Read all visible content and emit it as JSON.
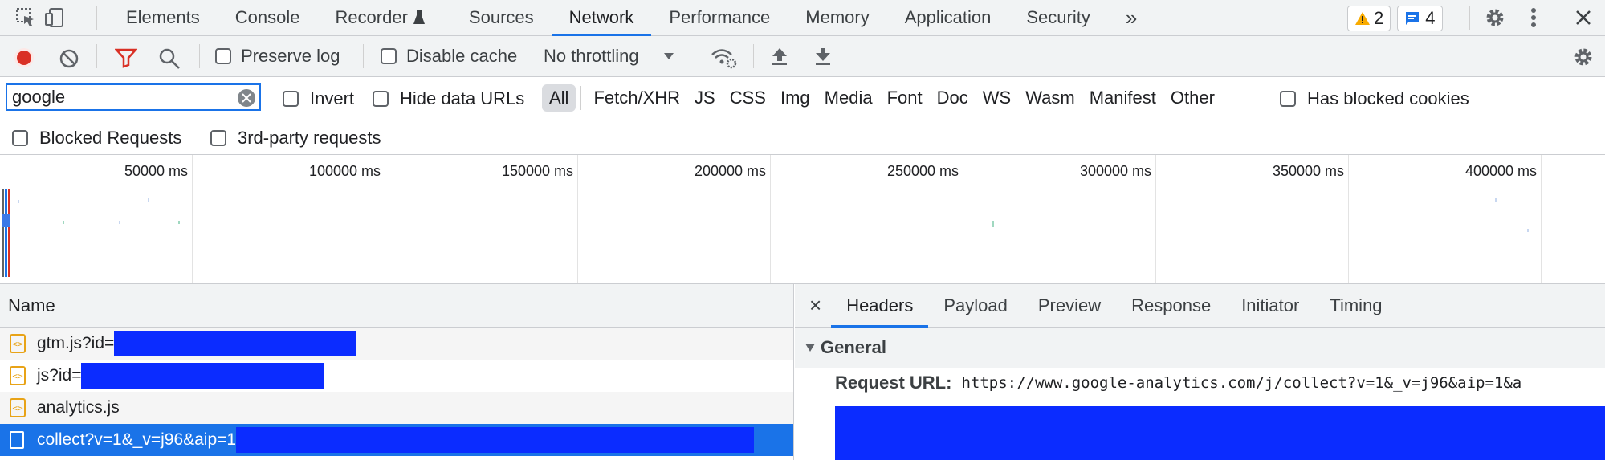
{
  "tabs": {
    "items": [
      "Elements",
      "Console",
      "Recorder",
      "Sources",
      "Network",
      "Performance",
      "Memory",
      "Application",
      "Security"
    ],
    "active": "Network",
    "more": "»"
  },
  "badges": {
    "warnings": "2",
    "messages": "4"
  },
  "toolbar": {
    "preserve_log": "Preserve log",
    "disable_cache": "Disable cache",
    "throttling": "No throttling"
  },
  "filter": {
    "value": "google",
    "invert": "Invert",
    "hide_data_urls": "Hide data URLs",
    "types": [
      "All",
      "Fetch/XHR",
      "JS",
      "CSS",
      "Img",
      "Media",
      "Font",
      "Doc",
      "WS",
      "Wasm",
      "Manifest",
      "Other"
    ],
    "selected_type": "All",
    "has_blocked_cookies": "Has blocked cookies",
    "blocked_requests": "Blocked Requests",
    "third_party": "3rd-party requests"
  },
  "overview": {
    "ticks": [
      "50000 ms",
      "100000 ms",
      "150000 ms",
      "200000 ms",
      "250000 ms",
      "300000 ms",
      "350000 ms",
      "400000 ms"
    ]
  },
  "requests": {
    "header": "Name",
    "rows": [
      {
        "name": "gtm.js?id=",
        "type": "script"
      },
      {
        "name": "js?id=",
        "type": "script"
      },
      {
        "name": "analytics.js",
        "type": "script"
      },
      {
        "name": "collect?v=1&_v=j96&aip=1",
        "type": "document",
        "selected": true
      }
    ]
  },
  "details": {
    "close": "×",
    "tabs": [
      "Headers",
      "Payload",
      "Preview",
      "Response",
      "Initiator",
      "Timing"
    ],
    "active": "Headers",
    "section": "General",
    "request_url_label": "Request URL:",
    "request_url_value": "https://www.google-analytics.com/j/collect?v=1&_v=j96&aip=1&a"
  },
  "colors": {
    "accent": "#1a73e8",
    "record": "#d93025",
    "filter_icon": "#d93025",
    "redaction": "#0b2cff"
  }
}
